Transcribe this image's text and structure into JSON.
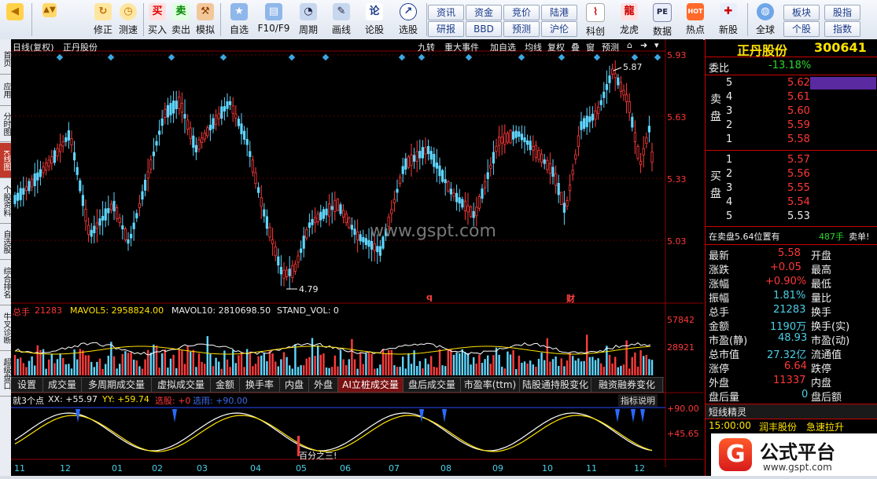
{
  "toolbar": {
    "buttons": [
      {
        "label": "",
        "icon": "back-arrow-icon"
      },
      {
        "label": "修正",
        "icon": "refresh-icon"
      },
      {
        "label": "测速",
        "icon": "clock-icon"
      },
      {
        "label": "买入",
        "icon": "buy-icon",
        "glyph": "买"
      },
      {
        "label": "卖出",
        "icon": "sell-icon",
        "glyph": "卖"
      },
      {
        "label": "模拟",
        "icon": "hammer-icon"
      },
      {
        "label": "自选",
        "icon": "folder-icon"
      },
      {
        "label": "F10/F9",
        "icon": "info-icon"
      },
      {
        "label": "周期",
        "icon": "period-icon"
      },
      {
        "label": "画线",
        "icon": "pen-icon"
      },
      {
        "label": "论股",
        "icon": "discuss-icon",
        "glyph": "论"
      },
      {
        "label": "选股",
        "icon": "select-icon"
      },
      {
        "label": "科创",
        "icon": "chart-icon"
      },
      {
        "label": "龙虎",
        "icon": "dragon-icon"
      },
      {
        "label": "数据",
        "icon": "data-icon",
        "glyph": "PE"
      },
      {
        "label": "热点",
        "icon": "hot-icon",
        "glyph": "HOT"
      },
      {
        "label": "新股",
        "icon": "newstock-icon"
      },
      {
        "label": "全球",
        "icon": "globe-icon"
      }
    ],
    "small_buttons": [
      "资讯",
      "资金",
      "竞价",
      "陆港",
      "研报",
      "BBD",
      "预测",
      "沪伦",
      "板块",
      "股指",
      "个股",
      "指数"
    ]
  },
  "left_tabs": [
    "首页",
    "应用",
    "分时图",
    "K线图",
    "个股资料",
    "自选股",
    "综合排名",
    "牛叉诊断",
    "超级盘口"
  ],
  "chart": {
    "top_left_labels": [
      "日线(复权)",
      "正丹股份"
    ],
    "top_right_buttons": [
      "九转",
      "重大事件",
      "加自选",
      "均线",
      "复权",
      "叠",
      "窗",
      "预测"
    ],
    "price_axis": [
      "5.93",
      "5.63",
      "5.33",
      "5.03"
    ],
    "high_label": "5.87",
    "low_label": "4.79",
    "markers": [
      "q",
      "财"
    ],
    "watermark": "www.gspt.com",
    "volume_header": {
      "name": "总手",
      "value": "21283",
      "mavol5": "MAVOL5: 2958824.00",
      "mavol10": "MAVOL10: 2810698.50",
      "stand": "STAND_VOL: 0"
    },
    "volume_axis": [
      "57842",
      "28921"
    ],
    "tabs": [
      "设置",
      "成交量",
      "多周期成交量",
      "虚拟成交量",
      "金额",
      "换手率",
      "内盘",
      "外盘",
      "AI立桩成交量",
      "盘后成交量",
      "市盈率(ttm)",
      "陆股通持股变化",
      "融资融券变化"
    ],
    "active_tab": "AI立桩成交量",
    "indicator_header": {
      "name": "就3个点",
      "xx": "XX: +55.97",
      "yy": "YY: +59.74",
      "xg": "选股: +0",
      "xd": "选雨: +90.00",
      "help": "指标说明"
    },
    "indicator_axis": [
      "+90.00",
      "+45.65"
    ],
    "indicator_note": "百分之三!",
    "months": [
      "11",
      "12",
      "01",
      "02",
      "03",
      "04",
      "05",
      "06",
      "07",
      "08",
      "09",
      "10",
      "11",
      "12"
    ]
  },
  "chart_data": {
    "type": "candlestick",
    "ylim": [
      4.79,
      5.93
    ],
    "high": 5.87,
    "low": 4.79
  },
  "quote": {
    "title": "正丹股份",
    "code": "300641",
    "weibi_label": "委比",
    "weibi_value": "-13.18%",
    "sell_label": "卖盘",
    "buy_label": "买盘",
    "sell": [
      {
        "n": "5",
        "p": "5.62"
      },
      {
        "n": "4",
        "p": "5.61"
      },
      {
        "n": "3",
        "p": "5.60"
      },
      {
        "n": "2",
        "p": "5.59"
      },
      {
        "n": "1",
        "p": "5.58"
      }
    ],
    "buy": [
      {
        "n": "1",
        "p": "5.57"
      },
      {
        "n": "2",
        "p": "5.56"
      },
      {
        "n": "3",
        "p": "5.55"
      },
      {
        "n": "4",
        "p": "5.54"
      },
      {
        "n": "5",
        "p": "5.53"
      }
    ],
    "notice": {
      "text": "在卖盘5.64位置有",
      "vol": "487手",
      "tail": "卖单!"
    },
    "stats": [
      {
        "l": "最新",
        "v": "5.58",
        "r": "开盘",
        "c": "red"
      },
      {
        "l": "涨跌",
        "v": "+0.05",
        "r": "最高",
        "c": "red"
      },
      {
        "l": "涨幅",
        "v": "+0.90%",
        "r": "最低",
        "c": "red"
      },
      {
        "l": "振幅",
        "v": "1.81%",
        "r": "量比",
        "c": "cyan"
      },
      {
        "l": "总手",
        "v": "21283",
        "r": "换手",
        "c": "cyan"
      },
      {
        "l": "金额",
        "v": "1190万",
        "r": "换手(实)",
        "c": "cyan"
      },
      {
        "l": "市盈(静)",
        "v": "48.93",
        "r": "市盈(动)",
        "c": "cyan"
      },
      {
        "l": "总市值",
        "v": "27.32亿",
        "r": "流通值",
        "c": "cyan"
      },
      {
        "l": "涨停",
        "v": "6.64",
        "r": "跌停",
        "c": "red"
      },
      {
        "l": "外盘",
        "v": "11337",
        "r": "内盘",
        "c": "red"
      },
      {
        "l": "盘后量",
        "v": "0",
        "r": "盘后额",
        "c": "cyan"
      }
    ],
    "news_header": "短线精灵",
    "news_time": "15:00:00",
    "news_name": "润丰股份",
    "news_event": "急速拉升"
  },
  "logo": {
    "text": "公式平台",
    "url": "www.gspt.com"
  }
}
